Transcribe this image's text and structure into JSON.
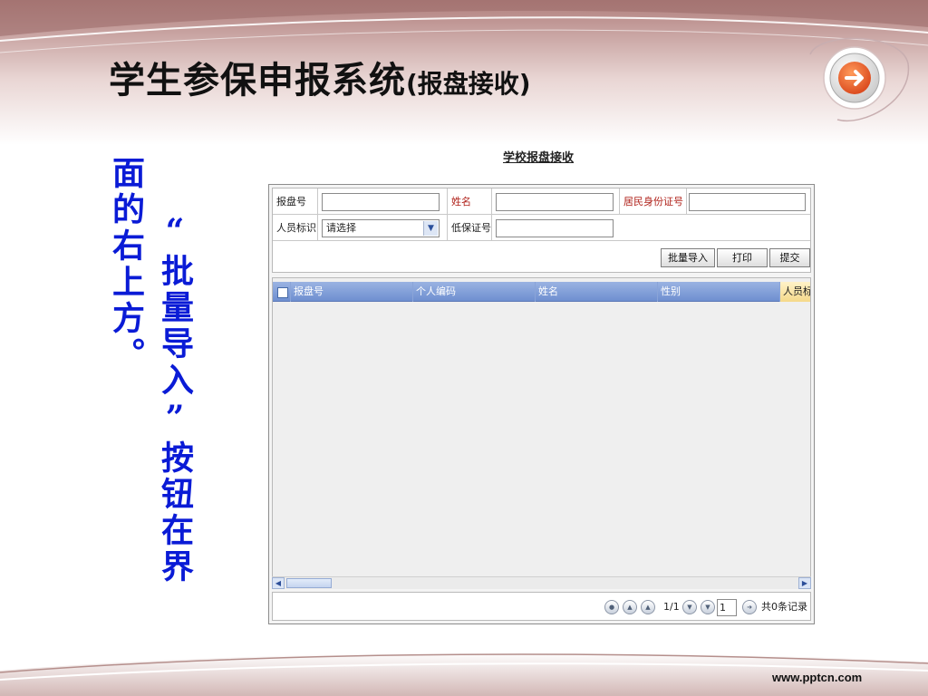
{
  "slide": {
    "title": "学生参保申报系统",
    "title_suffix": "(报盘接收)",
    "caption_line1": "“批量导入”按钮在界",
    "caption_line2": "面的右上方。",
    "footer_url": "www.pptcn.com"
  },
  "app": {
    "heading": "学校报盘接收",
    "form": {
      "disk_no_label": "报盘号",
      "disk_no_value": "",
      "name_label": "姓名",
      "name_value": "",
      "id_label": "居民身份证号",
      "id_value": "",
      "person_type_label": "人员标识",
      "person_type_value": "请选择",
      "low_insurance_label": "低保证号",
      "low_insurance_value": ""
    },
    "buttons": {
      "batch_import": "批量导入",
      "print": "打印",
      "submit": "提交"
    },
    "grid": {
      "columns": [
        "报盘号",
        "个人编码",
        "姓名",
        "性别",
        "人员标"
      ]
    },
    "pager": {
      "page_info": "1/1",
      "page_input": "1",
      "total": "共0条记录"
    }
  },
  "colors": {
    "caption": "#0a1bd6",
    "grid_header": "#7f9dd7",
    "label_red": "#b0221b"
  }
}
